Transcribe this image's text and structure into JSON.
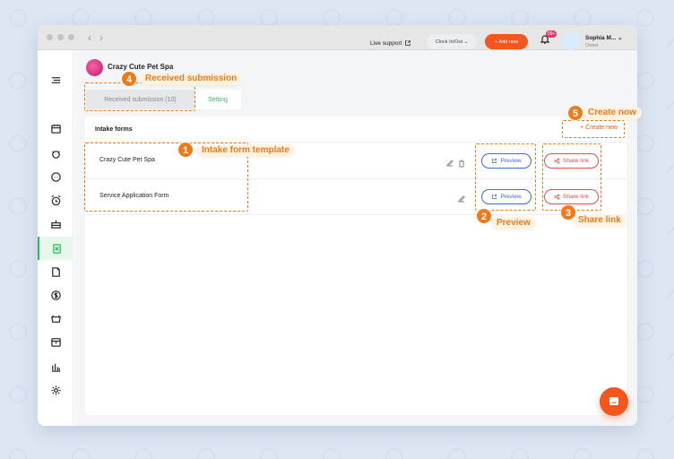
{
  "window": {
    "nav_back": "‹",
    "nav_forward": "›"
  },
  "sidebar": {
    "items": [
      {
        "icon": "menu-icon"
      },
      {
        "icon": "calendar-icon"
      },
      {
        "icon": "pet-icon"
      },
      {
        "icon": "chat-icon"
      },
      {
        "icon": "alarm-icon"
      },
      {
        "icon": "cake-icon"
      },
      {
        "icon": "intake-form-icon",
        "active": true
      },
      {
        "icon": "clipboard-icon"
      },
      {
        "icon": "dollar-icon"
      },
      {
        "icon": "basket-icon"
      },
      {
        "icon": "register-icon"
      },
      {
        "icon": "report-icon"
      },
      {
        "icon": "gear-icon"
      }
    ]
  },
  "header": {
    "business_name": "Crazy Cute Pet Spa",
    "live_support": "Live support",
    "clock_button": "Clock In/Out ⌄",
    "add_new_button": "+ Add new",
    "notification_badge": "99+",
    "user_name": "Sophia M... ⌄",
    "user_role": "Owner"
  },
  "tabs": {
    "received": "Received submission (10)",
    "setting": "Setting"
  },
  "panel": {
    "title": "Intake forms",
    "create_new": "+ Create new",
    "rows": [
      {
        "label": "Crazy Cute Pet Spa",
        "preview": "Preview",
        "share": "Share link"
      },
      {
        "label": "Service Application Form",
        "preview": "Preview",
        "share": "Share link"
      }
    ]
  },
  "callouts": [
    {
      "number": "1",
      "label": "Intake form template"
    },
    {
      "number": "2",
      "label": "Preview"
    },
    {
      "number": "3",
      "label": "Share link"
    },
    {
      "number": "4",
      "label": "Received submission"
    },
    {
      "number": "5",
      "label": "Create now"
    }
  ],
  "colors": {
    "accent": "#f4561e",
    "active": "#2fb95b",
    "callout": "#f07a1a",
    "preview": "#3a6ad6",
    "share": "#e84b4b"
  }
}
